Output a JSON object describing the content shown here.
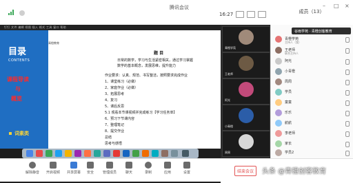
{
  "window": {
    "title": "腾讯会议",
    "time": "16:27",
    "signal_color": "#3aa757"
  },
  "participants_panel": {
    "header": "成员（13）",
    "tooltip": "谷雨学苑 · 青橙创客教育",
    "rows": [
      {
        "name": "青橙学苑",
        "sub": "主持人（我）"
      },
      {
        "name": "王老师",
        "sub": "联合主持人"
      },
      {
        "name": "阿光",
        "sub": ""
      },
      {
        "name": "小青橙",
        "sub": ""
      },
      {
        "name": "周周",
        "sub": ""
      },
      {
        "name": "学员",
        "sub": ""
      },
      {
        "name": "童童",
        "sub": ""
      },
      {
        "name": "乐乐",
        "sub": ""
      },
      {
        "name": "航航",
        "sub": ""
      },
      {
        "name": "李老师",
        "sub": ""
      },
      {
        "name": "家长",
        "sub": ""
      },
      {
        "name": "学员2",
        "sub": ""
      }
    ]
  },
  "share": {
    "menubar": "钉钉  文件  编辑  视图  插入  格式  工具  窗口  帮助",
    "slide_title": "目录",
    "slide_subtitle": "CONTENTS",
    "red_lines": [
      "课程导读",
      "与",
      "概览"
    ],
    "yellow_line": "词素类",
    "doc_corner": "青橙教育",
    "doc_heading": "题 目",
    "doc_lines": [
      "日常的数学，学习与生活紧密相关，通过学习掌握",
      "数学的基本概念，发展思维，提升能力",
      "",
      "作业要求：认真、规范、书写整洁，按照要求完成作业",
      "1、课堂练习（必做）",
      "2、家庭作业（必做）",
      "3、拓展思考",
      "4、复习",
      "5、课后反思",
      "5.1 观看本节课视频并完成练习【学习任务单】",
      "6、预习下节课内容",
      "7、整理笔记",
      "8、提交作业",
      "总结",
      "思考与感悟"
    ]
  },
  "video_tiles": [
    {
      "name": "青橙学苑"
    },
    {
      "name": "王老师"
    },
    {
      "name": "阿光"
    },
    {
      "name": "小青橙"
    },
    {
      "name": "周周"
    }
  ],
  "toolbar": {
    "items": [
      {
        "label": "解除静音"
      },
      {
        "label": "开启视频"
      },
      {
        "label": "共享屏幕"
      },
      {
        "label": "安全"
      },
      {
        "label": "管理成员"
      },
      {
        "label": "聊天"
      },
      {
        "label": "录制"
      },
      {
        "label": "应用"
      },
      {
        "label": "设置"
      }
    ],
    "end_label": "结束会议"
  },
  "watermark": "头条 @青橙创客教育"
}
